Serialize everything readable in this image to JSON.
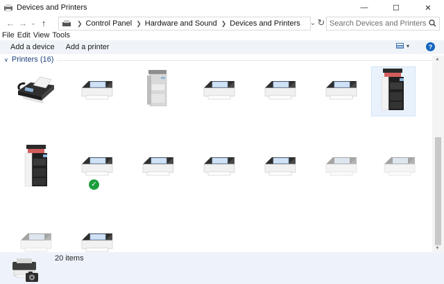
{
  "window": {
    "title": "Devices and Printers",
    "controls": {
      "minimize": "—",
      "maximize": "☐",
      "close": "✕"
    }
  },
  "nav": {
    "back": "←",
    "forward": "→",
    "recent": "⌄",
    "up": "↑",
    "breadcrumbs": [
      "Control Panel",
      "Hardware and Sound",
      "Devices and Printers"
    ],
    "dropdown": "⌄",
    "refresh": "↻",
    "search_placeholder": "Search Devices and Printers"
  },
  "menu": [
    "File",
    "Edit",
    "View",
    "Tools"
  ],
  "commands": {
    "add_device": "Add a device",
    "add_printer": "Add a printer",
    "help": "?"
  },
  "section": {
    "label": "Printers (16)"
  },
  "devices": [
    {
      "kind": "fax"
    },
    {
      "kind": "printer-dark"
    },
    {
      "kind": "copier-gray"
    },
    {
      "kind": "printer-dark"
    },
    {
      "kind": "printer-dark"
    },
    {
      "kind": "printer-dark"
    },
    {
      "kind": "mfp-black",
      "selected": true
    },
    {
      "kind": "mfp-black"
    },
    {
      "kind": "printer-dark",
      "default": true
    },
    {
      "kind": "printer-dark"
    },
    {
      "kind": "printer-dark"
    },
    {
      "kind": "printer-dark"
    },
    {
      "kind": "printer-faded"
    },
    {
      "kind": "printer-faded"
    },
    {
      "kind": "printer-faded"
    },
    {
      "kind": "printer-dark"
    }
  ],
  "status": {
    "count": "20 items"
  },
  "colors": {
    "accent": "#1565c0",
    "command_bar": "#f0f4f9",
    "status_bar": "#eef3fb",
    "default_check": "#1c9e3d"
  }
}
